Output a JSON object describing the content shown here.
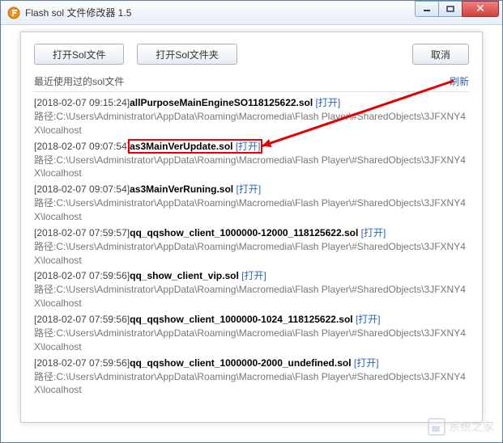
{
  "window": {
    "title": "Flash sol 文件修改器 1.5"
  },
  "toolbar": {
    "open_file": "打开Sol文件",
    "open_folder": "打开Sol文件夹",
    "cancel": "取消"
  },
  "recent": {
    "label": "最近使用过的sol文件",
    "refresh": "刷新",
    "open_text": "[打开]",
    "path_prefix": "路径:",
    "entries": [
      {
        "ts": "[2018-02-07 09:15:24]",
        "name": "allPurposeMainEngineSO118125622.sol",
        "path": "C:\\Users\\Administrator\\AppData\\Roaming\\Macromedia\\Flash Player\\#SharedObjects\\3JFXNY4X\\localhost"
      },
      {
        "ts": "[2018-02-07 09:07:54]",
        "name": "as3MainVerUpdate.sol",
        "path": "C:\\Users\\Administrator\\AppData\\Roaming\\Macromedia\\Flash Player\\#SharedObjects\\3JFXNY4X\\localhost"
      },
      {
        "ts": "[2018-02-07 09:07:54]",
        "name": "as3MainVerRuning.sol",
        "path": "C:\\Users\\Administrator\\AppData\\Roaming\\Macromedia\\Flash Player\\#SharedObjects\\3JFXNY4X\\localhost"
      },
      {
        "ts": "[2018-02-07 07:59:57]",
        "name": "qq_qqshow_client_1000000-12000_118125622.sol",
        "path": "C:\\Users\\Administrator\\AppData\\Roaming\\Macromedia\\Flash Player\\#SharedObjects\\3JFXNY4X\\localhost"
      },
      {
        "ts": "[2018-02-07 07:59:56]",
        "name": "qq_show_client_vip.sol",
        "path": "C:\\Users\\Administrator\\AppData\\Roaming\\Macromedia\\Flash Player\\#SharedObjects\\3JFXNY4X\\localhost"
      },
      {
        "ts": "[2018-02-07 07:59:56]",
        "name": "qq_qqshow_client_1000000-1024_118125622.sol",
        "path": "C:\\Users\\Administrator\\AppData\\Roaming\\Macromedia\\Flash Player\\#SharedObjects\\3JFXNY4X\\localhost"
      },
      {
        "ts": "[2018-02-07 07:59:56]",
        "name": "qq_qqshow_client_1000000-2000_undefined.sol",
        "path": "C:\\Users\\Administrator\\AppData\\Roaming\\Macromedia\\Flash Player\\#SharedObjects\\3JFXNY4X\\localhost"
      }
    ]
  },
  "annotation": {
    "highlight_index": 1
  },
  "watermark": {
    "text": "系统之家"
  }
}
